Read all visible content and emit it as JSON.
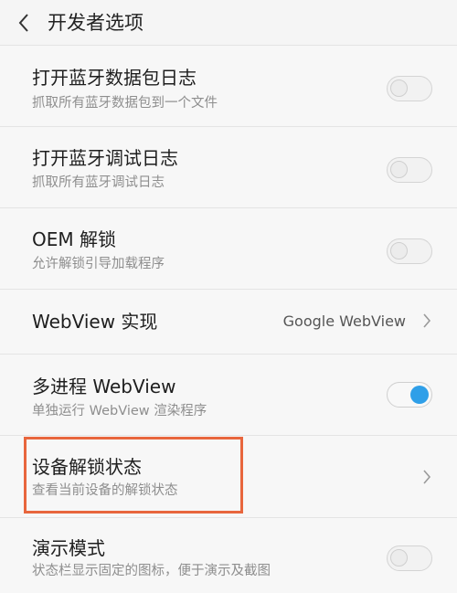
{
  "header": {
    "title": "开发者选项",
    "back_icon": "chevron-left-icon"
  },
  "items": [
    {
      "label": "打开蓝牙数据包日志",
      "sub": "抓取所有蓝牙数据包到一个文件",
      "control": "toggle",
      "checked": false
    },
    {
      "label": "打开蓝牙调试日志",
      "sub": "抓取所有蓝牙调试日志",
      "control": "toggle",
      "checked": false
    },
    {
      "label": "OEM 解锁",
      "sub": "允许解锁引导加载程序",
      "control": "toggle",
      "checked": false
    },
    {
      "label": "WebView 实现",
      "value": "Google WebView",
      "control": "chevron"
    },
    {
      "label": "多进程 WebView",
      "sub": "单独运行 WebView 渲染程序",
      "control": "toggle",
      "checked": true
    },
    {
      "label": "设备解锁状态",
      "sub": "查看当前设备的解锁状态",
      "control": "chevron",
      "highlighted": true
    },
    {
      "label": "演示模式",
      "sub": "状态栏显示固定的图标，便于演示及截图",
      "control": "toggle",
      "checked": false
    }
  ],
  "colors": {
    "accent": "#2f9fe8",
    "highlight": "#e8663d"
  }
}
